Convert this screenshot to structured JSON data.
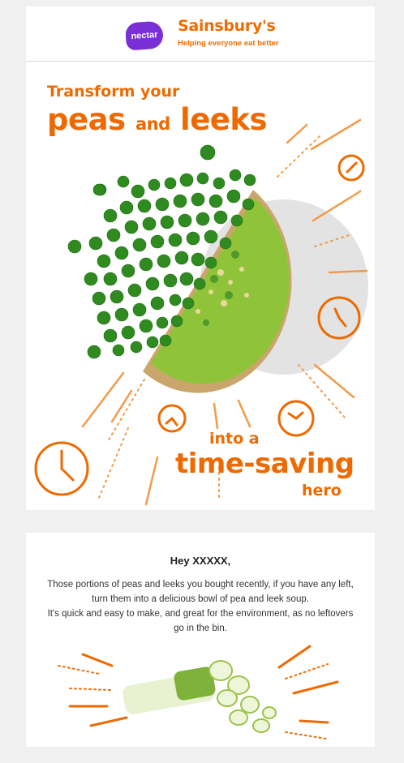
{
  "header": {
    "nectar_label": "nectar",
    "brand_name": "Sainsbury's",
    "brand_tagline": "Helping everyone eat better"
  },
  "hero": {
    "line1": "Transform your",
    "line2a": "peas",
    "line2b": "and",
    "line2c": "leeks",
    "line3": "into a",
    "line4": "time-saving",
    "line5": "hero"
  },
  "message": {
    "greeting": "Hey XXXXX,",
    "paragraph1": "Those portions of peas and leeks you bought recently, if you have any left, turn them into a delicious bowl of pea and leek soup.",
    "paragraph2": "It's quick and easy to make, and great for the environment, as no leftovers go in the bin."
  },
  "colors": {
    "brand_orange": "#f06c00",
    "nectar_purple": "#7a2fd6",
    "pea_green": "#2f8a1f",
    "soup_green": "#8fc43a",
    "background": "#f0f0f0"
  },
  "icons": [
    "nectar-logo-icon",
    "clock-icon",
    "leek-illustration",
    "soup-bowl-illustration"
  ]
}
